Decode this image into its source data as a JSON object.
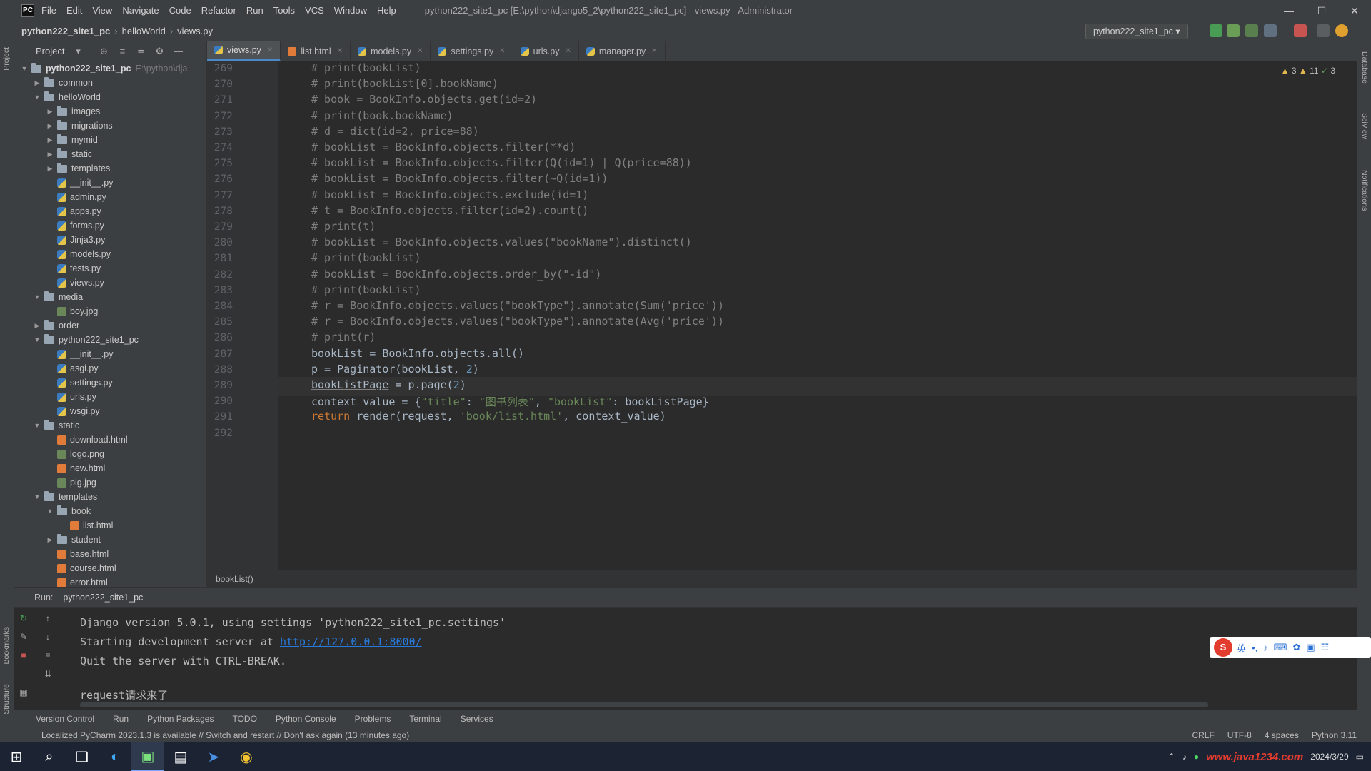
{
  "window": {
    "menu": [
      "File",
      "Edit",
      "View",
      "Navigate",
      "Code",
      "Refactor",
      "Run",
      "Tools",
      "VCS",
      "Window",
      "Help"
    ],
    "title": "python222_site1_pc [E:\\python\\django5_2\\python222_site1_pc] - views.py - Administrator",
    "controls": [
      "—",
      "☐",
      "✕"
    ]
  },
  "navbar": {
    "project": "python222_site1_pc",
    "module": "helloWorld",
    "file": "views.py",
    "run_config": "python222_site1_pc"
  },
  "left_strip": [
    "Project",
    "Bookmarks",
    "Structure"
  ],
  "right_strip": [
    "Database",
    "SciView",
    "Notifications"
  ],
  "project_panel": {
    "title": "Project",
    "tree": [
      {
        "indent": 0,
        "arrow": "▼",
        "type": "folder",
        "name": "python222_site1_pc",
        "extra": "E:\\python\\dja",
        "bold": true
      },
      {
        "indent": 1,
        "arrow": "▶",
        "type": "folder",
        "name": "common"
      },
      {
        "indent": 1,
        "arrow": "▼",
        "type": "folder",
        "name": "helloWorld"
      },
      {
        "indent": 2,
        "arrow": "▶",
        "type": "folder",
        "name": "images"
      },
      {
        "indent": 2,
        "arrow": "▶",
        "type": "folder",
        "name": "migrations"
      },
      {
        "indent": 2,
        "arrow": "▶",
        "type": "folder",
        "name": "mymid"
      },
      {
        "indent": 2,
        "arrow": "▶",
        "type": "folder",
        "name": "static"
      },
      {
        "indent": 2,
        "arrow": "▶",
        "type": "folder",
        "name": "templates"
      },
      {
        "indent": 2,
        "arrow": "",
        "type": "py",
        "name": "__init__.py"
      },
      {
        "indent": 2,
        "arrow": "",
        "type": "py",
        "name": "admin.py"
      },
      {
        "indent": 2,
        "arrow": "",
        "type": "py",
        "name": "apps.py"
      },
      {
        "indent": 2,
        "arrow": "",
        "type": "py",
        "name": "forms.py"
      },
      {
        "indent": 2,
        "arrow": "",
        "type": "py",
        "name": "Jinja3.py"
      },
      {
        "indent": 2,
        "arrow": "",
        "type": "py",
        "name": "models.py"
      },
      {
        "indent": 2,
        "arrow": "",
        "type": "py",
        "name": "tests.py"
      },
      {
        "indent": 2,
        "arrow": "",
        "type": "py",
        "name": "views.py"
      },
      {
        "indent": 1,
        "arrow": "▼",
        "type": "folder",
        "name": "media"
      },
      {
        "indent": 2,
        "arrow": "",
        "type": "img",
        "name": "boy.jpg"
      },
      {
        "indent": 1,
        "arrow": "▶",
        "type": "folder",
        "name": "order"
      },
      {
        "indent": 1,
        "arrow": "▼",
        "type": "folder",
        "name": "python222_site1_pc"
      },
      {
        "indent": 2,
        "arrow": "",
        "type": "py",
        "name": "__init__.py"
      },
      {
        "indent": 2,
        "arrow": "",
        "type": "py",
        "name": "asgi.py"
      },
      {
        "indent": 2,
        "arrow": "",
        "type": "py",
        "name": "settings.py"
      },
      {
        "indent": 2,
        "arrow": "",
        "type": "py",
        "name": "urls.py"
      },
      {
        "indent": 2,
        "arrow": "",
        "type": "py",
        "name": "wsgi.py"
      },
      {
        "indent": 1,
        "arrow": "▼",
        "type": "folder",
        "name": "static"
      },
      {
        "indent": 2,
        "arrow": "",
        "type": "html",
        "name": "download.html"
      },
      {
        "indent": 2,
        "arrow": "",
        "type": "img",
        "name": "logo.png"
      },
      {
        "indent": 2,
        "arrow": "",
        "type": "html",
        "name": "new.html"
      },
      {
        "indent": 2,
        "arrow": "",
        "type": "img",
        "name": "pig.jpg"
      },
      {
        "indent": 1,
        "arrow": "▼",
        "type": "folder",
        "name": "templates"
      },
      {
        "indent": 2,
        "arrow": "▼",
        "type": "folder",
        "name": "book"
      },
      {
        "indent": 3,
        "arrow": "",
        "type": "html",
        "name": "list.html"
      },
      {
        "indent": 2,
        "arrow": "▶",
        "type": "folder",
        "name": "student"
      },
      {
        "indent": 2,
        "arrow": "",
        "type": "html",
        "name": "base.html"
      },
      {
        "indent": 2,
        "arrow": "",
        "type": "html",
        "name": "course.html"
      },
      {
        "indent": 2,
        "arrow": "",
        "type": "html",
        "name": "error.html"
      }
    ]
  },
  "tabs": [
    {
      "name": "views.py",
      "type": "py",
      "active": true
    },
    {
      "name": "list.html",
      "type": "html",
      "active": false
    },
    {
      "name": "models.py",
      "type": "py",
      "active": false
    },
    {
      "name": "settings.py",
      "type": "py",
      "active": false
    },
    {
      "name": "urls.py",
      "type": "py",
      "active": false
    },
    {
      "name": "manager.py",
      "type": "py",
      "active": false
    }
  ],
  "inspection": {
    "warnings": "3",
    "weak_warnings": "11",
    "ok": "3"
  },
  "editor": {
    "current_line": "289",
    "lines": [
      {
        "n": "269",
        "t": "# print(bookList)"
      },
      {
        "n": "270",
        "t": "# print(bookList[0].bookName)"
      },
      {
        "n": "271",
        "t": "# book = BookInfo.objects.get(id=2)"
      },
      {
        "n": "272",
        "t": "# print(book.bookName)"
      },
      {
        "n": "273",
        "t": "# d = dict(id=2, price=88)"
      },
      {
        "n": "274",
        "t": "# bookList = BookInfo.objects.filter(**d)"
      },
      {
        "n": "275",
        "t": "# bookList = BookInfo.objects.filter(Q(id=1) | Q(price=88))"
      },
      {
        "n": "276",
        "t": "# bookList = BookInfo.objects.filter(~Q(id=1))"
      },
      {
        "n": "277",
        "t": "# bookList = BookInfo.objects.exclude(id=1)"
      },
      {
        "n": "278",
        "t": "# t = BookInfo.objects.filter(id=2).count()"
      },
      {
        "n": "279",
        "t": "# print(t)"
      },
      {
        "n": "280",
        "t": "# bookList = BookInfo.objects.values(\"bookName\").distinct()"
      },
      {
        "n": "281",
        "t": "# print(bookList)"
      },
      {
        "n": "282",
        "t": "# bookList = BookInfo.objects.order_by(\"-id\")"
      },
      {
        "n": "283",
        "t": "# print(bookList)"
      },
      {
        "n": "284",
        "t": "# r = BookInfo.objects.values(\"bookType\").annotate(Sum('price'))"
      },
      {
        "n": "285",
        "t": "# r = BookInfo.objects.values(\"bookType\").annotate(Avg('price'))"
      },
      {
        "n": "286",
        "t": "# print(r)"
      },
      {
        "n": "287",
        "t": "bookList = BookInfo.objects.all()"
      },
      {
        "n": "288",
        "t": "p = Paginator(bookList, 2)"
      },
      {
        "n": "289",
        "t": "bookListPage = p.page(2)"
      },
      {
        "n": "290",
        "t": "context_value = {\"title\": \"图书列表\", \"bookList\": bookListPage}"
      },
      {
        "n": "291",
        "t": "return render(request, 'book/list.html', context_value)"
      },
      {
        "n": "292",
        "t": ""
      }
    ]
  },
  "breadcrumb_bar": "bookList()",
  "run_panel": {
    "label": "Run:",
    "tab": "python222_site1_pc",
    "console": [
      "Django version 5.0.1, using settings 'python222_site1_pc.settings'",
      "Starting development server at ",
      "Quit the server with CTRL-BREAK.",
      "",
      "request请求来了"
    ],
    "server_url": "http://127.0.0.1:8000/"
  },
  "ime": {
    "lang": "英"
  },
  "tool_windows": [
    "Version Control",
    "Run",
    "Python Packages",
    "TODO",
    "Python Console",
    "Problems",
    "Terminal",
    "Services"
  ],
  "status": {
    "message": "Localized PyCharm 2023.1.3 is available // Switch and restart // Don't ask again (13 minutes ago)",
    "right": [
      "CRLF",
      "UTF-8",
      "4 spaces",
      "Python 3.11"
    ]
  },
  "taskbar": {
    "watermark": "www.java1234.com",
    "date": "2024/3/29"
  }
}
